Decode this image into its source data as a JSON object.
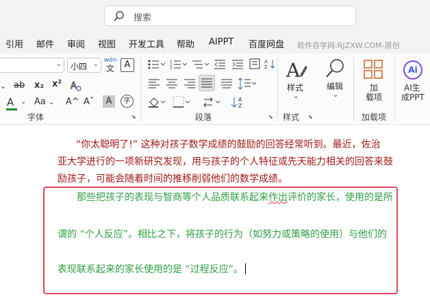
{
  "search": {
    "placeholder": "搜索"
  },
  "tabs": [
    "引用",
    "邮件",
    "审阅",
    "视图",
    "开发工具",
    "帮助",
    "AIPPT",
    "百度网盘"
  ],
  "watermark": "软件自学网:RJZXW.COM-原创",
  "ribbon": {
    "font_size": "小四",
    "wen_top": "wén",
    "wen_bottom": "文",
    "clear_format_glyph": "A",
    "strike": "ab",
    "sub": "x₂",
    "sup": "x²",
    "font_color_letter": "A",
    "case_label": "Aa",
    "grow_font": "A^",
    "shrink_font": "Aˇ",
    "char_shade": "A",
    "enclose_char": "字",
    "font_group": "字体",
    "paragraph_group": "段落",
    "styles_button": "样式",
    "styles_group": "样式",
    "edit_button": "编辑",
    "addin_button_line1": "加",
    "addin_button_line2": "载项",
    "addin_group": "加载项",
    "ai_badge": "Ai",
    "ai_line1": "AI生",
    "ai_line2": "成PPT"
  },
  "document": {
    "red_lines": [
      "“你太聪明了!” 这种对孩子数学成绩的鼓励的回答经常听到。最近，佐治",
      "亚大学进行的一项新研究发现，用与孩子的个人特征或先天能力相关的回答来鼓",
      "励孩子，可能会随着时间的推移削弱他们的数学成绩。"
    ],
    "green_line1_before": "那些把孩子的表现与智商等个人品质联系起来",
    "green_line1_mark": "作出",
    "green_line1_after": "评价的家长，使用的是所",
    "green_line2": "谓的 “个人反应”。相比之下，将孩子的行为（如努力或策略的使用）与他们的",
    "green_line3": "表现联系起来的家长使用的是 “过程反应”。"
  },
  "colors": {
    "red_text": "#a01818",
    "green_text": "#2f9e44",
    "selection_border": "#e0475a"
  }
}
